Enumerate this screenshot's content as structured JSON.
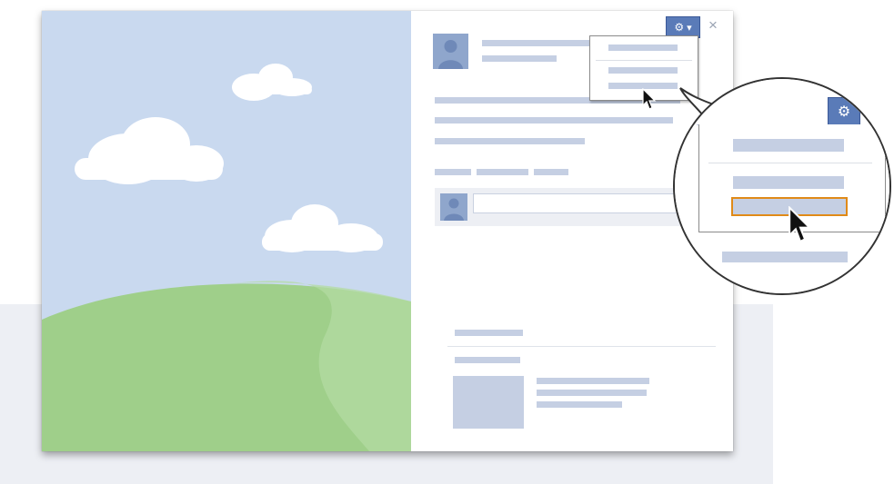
{
  "scene": {
    "description_icons": [
      "gear-icon",
      "chevron-down-icon",
      "close-icon",
      "cursor-icon",
      "person-icon"
    ]
  },
  "colors": {
    "sky": "#c9d9ef",
    "cloud": "#ffffff",
    "hill_light": "#a9d596",
    "hill_dark": "#9fcf8a",
    "placeholder_bar": "#c5cfe3",
    "accent": "#5a7bb8",
    "highlight": "#e08a18"
  },
  "dialog": {
    "close_symbol": "×",
    "gear_symbol": "⚙",
    "chevron_symbol": "▾"
  },
  "zoom_view": {
    "gear_symbol": "⚙",
    "highlighted_item": 3
  }
}
